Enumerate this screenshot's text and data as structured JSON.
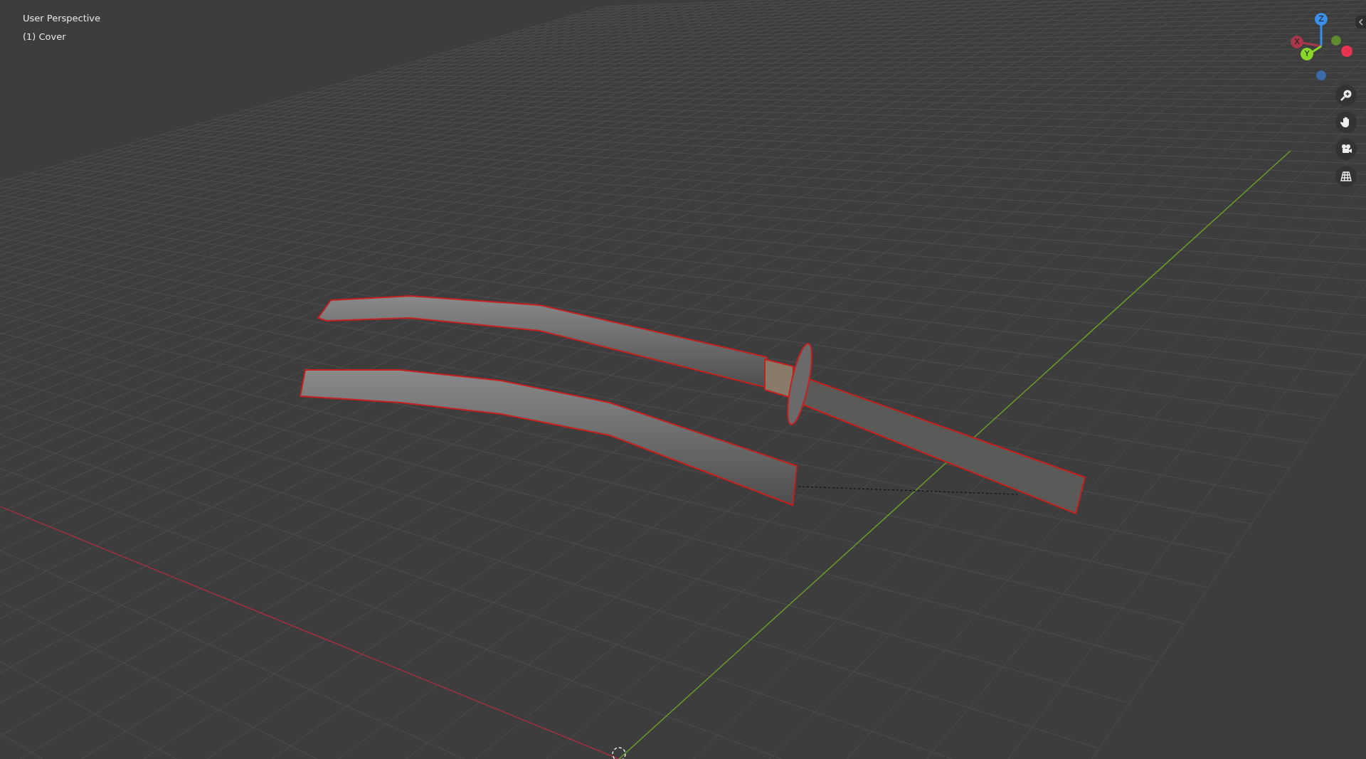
{
  "viewport": {
    "view_name": "User Perspective",
    "collection_label": "(1) Cover"
  },
  "gizmo": {
    "axes": [
      {
        "label": "Z",
        "color": "#3b8fe8"
      },
      {
        "label": "X",
        "color": "#a8384a"
      },
      {
        "label": "Y",
        "color": "#8bd62a"
      }
    ]
  }
}
